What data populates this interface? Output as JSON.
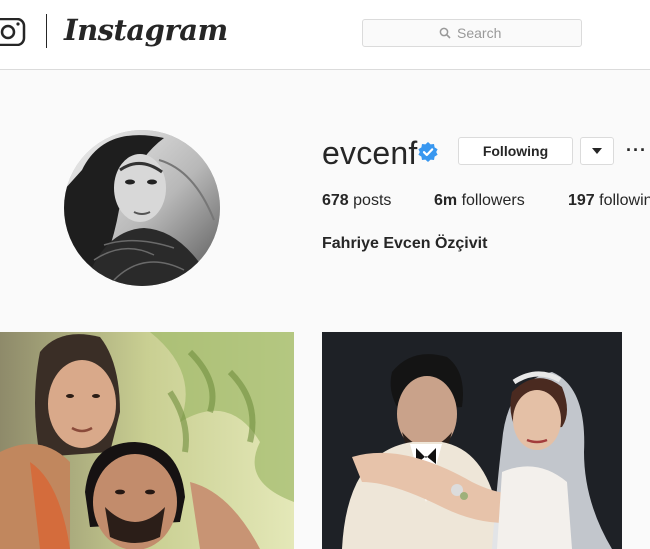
{
  "header": {
    "logo_text": "Instagram",
    "search_placeholder": "Search"
  },
  "profile": {
    "username": "evcenf",
    "verified": true,
    "follow_button_label": "Following",
    "more_label": "···",
    "posts_count": "678",
    "posts_label": "posts",
    "followers_count": "6m",
    "followers_label": "followers",
    "following_count": "197",
    "following_label": "following",
    "full_name": "Fahriye Evcen Özçivit"
  },
  "colors": {
    "verified_blue": "#3897f0",
    "border": "#dbdbdb",
    "background": "#fafafa"
  },
  "icons": [
    "instagram-camera-icon",
    "search-icon",
    "verified-badge-icon",
    "chevron-down-icon",
    "more-options-icon"
  ]
}
